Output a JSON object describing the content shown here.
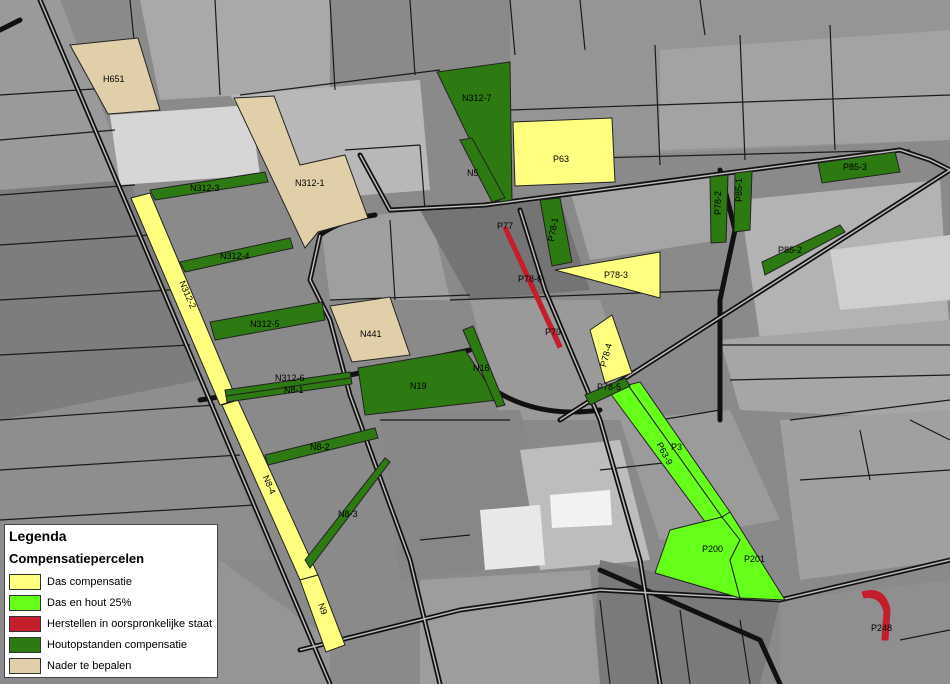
{
  "map": {
    "parcels": [
      {
        "id": "H651",
        "category": "nader"
      },
      {
        "id": "N312-7",
        "category": "hout"
      },
      {
        "id": "N5",
        "category": "hout"
      },
      {
        "id": "P63",
        "category": "das"
      },
      {
        "id": "N312-1",
        "category": "nader"
      },
      {
        "id": "N312-3",
        "category": "hout"
      },
      {
        "id": "P85-3",
        "category": "hout"
      },
      {
        "id": "P78-2",
        "category": "hout"
      },
      {
        "id": "P85-1",
        "category": "hout"
      },
      {
        "id": "P78-1",
        "category": "hout"
      },
      {
        "id": "P77",
        "category": "herstel"
      },
      {
        "id": "P85-2",
        "category": "hout"
      },
      {
        "id": "N312-4",
        "category": "hout"
      },
      {
        "id": "P78-6",
        "category": "none"
      },
      {
        "id": "P78-3",
        "category": "das"
      },
      {
        "id": "N312-2",
        "category": "das"
      },
      {
        "id": "N312-5",
        "category": "hout"
      },
      {
        "id": "N441",
        "category": "nader"
      },
      {
        "id": "P79",
        "category": "herstel"
      },
      {
        "id": "P78-4",
        "category": "das"
      },
      {
        "id": "N16",
        "category": "hout"
      },
      {
        "id": "N312-6",
        "category": "hout"
      },
      {
        "id": "N8-1",
        "category": "hout"
      },
      {
        "id": "N19",
        "category": "hout"
      },
      {
        "id": "P78-5",
        "category": "hout"
      },
      {
        "id": "P3",
        "category": "dashout"
      },
      {
        "id": "P63-9",
        "category": "dashout"
      },
      {
        "id": "N8-2",
        "category": "hout"
      },
      {
        "id": "N8-4",
        "category": "das"
      },
      {
        "id": "N8-3",
        "category": "hout"
      },
      {
        "id": "P200",
        "category": "dashout"
      },
      {
        "id": "P201",
        "category": "dashout"
      },
      {
        "id": "N9",
        "category": "das"
      },
      {
        "id": "P248",
        "category": "herstel"
      }
    ]
  },
  "legend": {
    "title": "Legenda",
    "subtitle": "Compensatiepercelen",
    "items": [
      {
        "label": "Das compensatie",
        "color": "#ffff80"
      },
      {
        "label": "Das en hout 25%",
        "color": "#66ff1a"
      },
      {
        "label": "Herstellen in oorspronkelijke staat",
        "color": "#c41e2c"
      },
      {
        "label": "Houtopstanden compensatie",
        "color": "#2e7a12"
      },
      {
        "label": "Nader te bepalen",
        "color": "#e0cfa8"
      }
    ]
  }
}
